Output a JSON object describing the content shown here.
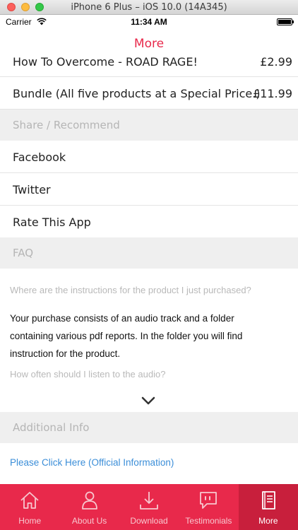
{
  "window": {
    "title": "iPhone 6 Plus – iOS 10.0 (14A345)"
  },
  "status_bar": {
    "carrier": "Carrier",
    "time": "11:34 AM"
  },
  "nav": {
    "title": "More"
  },
  "products": [
    {
      "name": "How To Overcome - ROAD RAGE!",
      "price": "£2.99"
    },
    {
      "name": "Bundle (All five products at a Special Price.)",
      "price": "£11.99"
    }
  ],
  "share": {
    "header": "Share / Recommend",
    "items": [
      "Facebook",
      "Twitter",
      "Rate This App"
    ]
  },
  "faq": {
    "header": "FAQ",
    "q1": "Where are the instructions for the product I just purchased?",
    "a1_lines": [
      "Your purchase consists of an audio track and a folder",
      "containing various pdf reports.  In the folder you will find",
      "instruction for the product."
    ],
    "q2": "How often should I listen to the audio?"
  },
  "additional": {
    "header": "Additional Info",
    "link": "Please Click Here (Official Information)"
  },
  "tabs": [
    {
      "label": "Home",
      "icon": "home-icon"
    },
    {
      "label": "About Us",
      "icon": "person-icon"
    },
    {
      "label": "Download",
      "icon": "download-icon"
    },
    {
      "label": "Testimonials",
      "icon": "quote-bubble-icon"
    },
    {
      "label": "More",
      "icon": "book-icon",
      "active": true
    }
  ],
  "colors": {
    "accent": "#e8294b",
    "active_tab": "#c81f3c",
    "link": "#3b8ed8",
    "section_bg": "#efefef"
  }
}
